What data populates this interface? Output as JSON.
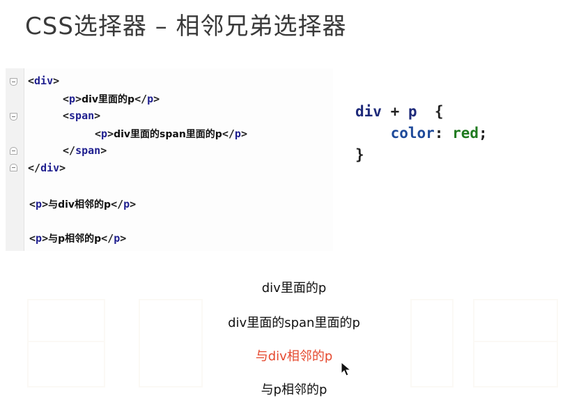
{
  "title": "CSS选择器 – 相邻兄弟选择器",
  "code": {
    "lines": [
      {
        "open": "<",
        "tag": "div",
        "close": ">",
        "text": ""
      },
      {
        "open": "<",
        "tag": "p",
        "close": ">",
        "text": "div里面的p",
        "endOpen": "</",
        "endTag": "p",
        "endClose": ">"
      },
      {
        "open": "<",
        "tag": "span",
        "close": ">",
        "text": ""
      },
      {
        "open": "<",
        "tag": "p",
        "close": ">",
        "text": "div里面的span里面的p",
        "endOpen": "</",
        "endTag": "p",
        "endClose": ">"
      },
      {
        "open": "</",
        "tag": "span",
        "close": ">",
        "text": ""
      },
      {
        "open": "</",
        "tag": "div",
        "close": ">",
        "text": ""
      },
      {
        "open": "<",
        "tag": "p",
        "close": ">",
        "text": "与div相邻的p",
        "endOpen": "</",
        "endTag": "p",
        "endClose": ">"
      },
      {
        "open": "<",
        "tag": "p",
        "close": ">",
        "text": "与p相邻的p",
        "endOpen": "</",
        "endTag": "p",
        "endClose": ">"
      }
    ]
  },
  "css": {
    "selector_a": "div",
    "combinator": "+",
    "selector_b": "p",
    "open_brace": "{",
    "property": "color",
    "colon": ":",
    "value": "red",
    "semicolon": ";",
    "close_brace": "}"
  },
  "output": {
    "line1": "div里面的p",
    "line2": "div里面的span里面的p",
    "line3": "与div相邻的p",
    "line4": "与p相邻的p",
    "highlight_color": "#e5492f"
  }
}
